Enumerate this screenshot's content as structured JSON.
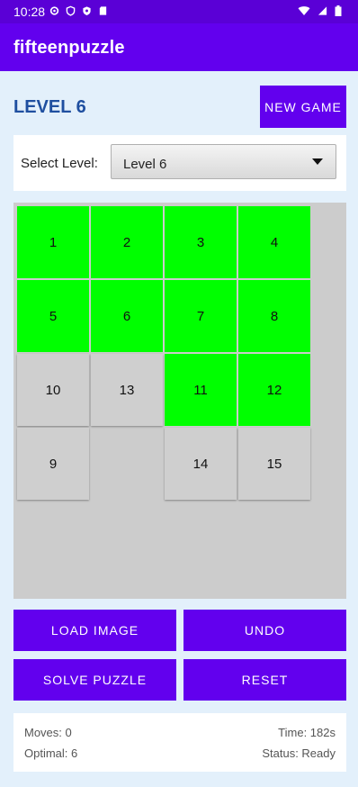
{
  "status_bar": {
    "time": "10:28",
    "left_icons": [
      "gear-icon",
      "shield-icon",
      "play-protect-icon",
      "sd-card-icon"
    ],
    "right_icons": [
      "wifi-icon",
      "signal-icon",
      "battery-icon"
    ]
  },
  "app_bar": {
    "title": "fifteenpuzzle"
  },
  "header": {
    "level_title": "LEVEL 6",
    "new_game_label": "NEW GAME"
  },
  "level_select": {
    "label": "Select Level:",
    "selected": "Level 6"
  },
  "board": {
    "solved_color": "#00ff00",
    "unsolved_color": "#cfcfcf",
    "tiles": [
      {
        "label": "1",
        "row": 0,
        "col": 0,
        "solved": true
      },
      {
        "label": "2",
        "row": 0,
        "col": 1,
        "solved": true
      },
      {
        "label": "3",
        "row": 0,
        "col": 2,
        "solved": true
      },
      {
        "label": "4",
        "row": 0,
        "col": 3,
        "solved": true
      },
      {
        "label": "5",
        "row": 1,
        "col": 0,
        "solved": true
      },
      {
        "label": "6",
        "row": 1,
        "col": 1,
        "solved": true
      },
      {
        "label": "7",
        "row": 1,
        "col": 2,
        "solved": true
      },
      {
        "label": "8",
        "row": 1,
        "col": 3,
        "solved": true
      },
      {
        "label": "10",
        "row": 2,
        "col": 0,
        "solved": false
      },
      {
        "label": "13",
        "row": 2,
        "col": 1,
        "solved": false
      },
      {
        "label": "11",
        "row": 2,
        "col": 2,
        "solved": true
      },
      {
        "label": "12",
        "row": 2,
        "col": 3,
        "solved": true
      },
      {
        "label": "9",
        "row": 3,
        "col": 0,
        "solved": false
      },
      {
        "label": "14",
        "row": 3,
        "col": 2,
        "solved": false
      },
      {
        "label": "15",
        "row": 3,
        "col": 3,
        "solved": false
      }
    ]
  },
  "actions": {
    "load_image": "LOAD IMAGE",
    "undo": "UNDO",
    "solve_puzzle": "SOLVE PUZZLE",
    "reset": "RESET"
  },
  "stats": {
    "moves": "Moves: 0",
    "optimal": "Optimal: 6",
    "time": "Time: 182s",
    "status": "Status: Ready"
  },
  "colors": {
    "accent": "#6200ee",
    "status_bar": "#5a00d6",
    "title_text": "#1f4fa0",
    "background": "#e3f0fb"
  }
}
